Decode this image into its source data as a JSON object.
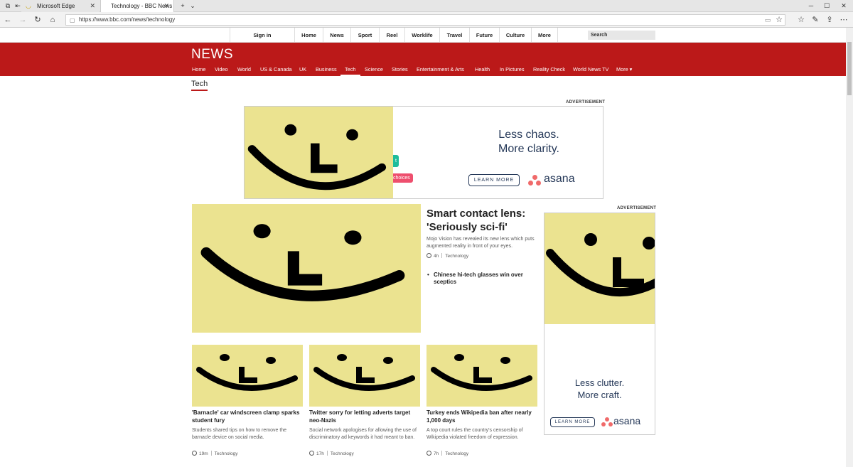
{
  "browser": {
    "tabs": [
      {
        "title": "Microsoft Edge"
      },
      {
        "title": "Technology - BBC News"
      }
    ],
    "url": "https://www.bbc.com/news/technology"
  },
  "bbc_nav": {
    "signin": "Sign in",
    "items": [
      "Home",
      "News",
      "Sport",
      "Reel",
      "Worklife",
      "Travel",
      "Future",
      "Culture",
      "More"
    ],
    "search_placeholder": "Search"
  },
  "news_header": {
    "logo": "NEWS",
    "items": [
      "Home",
      "Video",
      "World",
      "US & Canada",
      "UK",
      "Business",
      "Tech",
      "Science",
      "Stories",
      "Entertainment & Arts",
      "Health",
      "In Pictures",
      "Reality Check",
      "World News TV",
      "More"
    ],
    "active": "Tech"
  },
  "section_title": "Tech",
  "advert_label": "ADVERTISEMENT",
  "banner_ad": {
    "headline_line1": "Less chaos.",
    "headline_line2": "More clarity.",
    "button": "LEARN MORE",
    "brand": "asana",
    "chip_teal": "t",
    "chip_pink": "choices"
  },
  "side_ad": {
    "headline_line1": "Less clutter.",
    "headline_line2": "More craft.",
    "button": "LEARN MORE",
    "brand": "asana"
  },
  "top_story": {
    "title": "Smart contact lens: 'Seriously sci-fi'",
    "summary": "Mojo Vision has revealed its new lens which puts augmented reality in front of your eyes.",
    "time": "4h",
    "tag": "Technology",
    "related": "Chinese hi-tech glasses win over sceptics"
  },
  "stories": [
    {
      "title": "'Barnacle' car windscreen clamp sparks student fury",
      "summary": "Students shared tips on how to remove the barnacle device on social media.",
      "time": "19m",
      "tag": "Technology"
    },
    {
      "title": "Twitter sorry for letting adverts target neo-Nazis",
      "summary": "Social network apologises for allowing the use of discriminatory ad keywords it had meant to ban.",
      "time": "17h",
      "tag": "Technology"
    },
    {
      "title": "Turkey ends Wikipedia ban after nearly 1,000 days",
      "summary": "A top court rules the country's censorship of Wikipedia violated freedom of expression.",
      "time": "7h",
      "tag": "Technology"
    }
  ],
  "colors": {
    "bbc_red": "#bb1919",
    "placeholder_yellow": "#ebe390",
    "asana_navy": "#253858",
    "asana_coral": "#f06a6a"
  }
}
